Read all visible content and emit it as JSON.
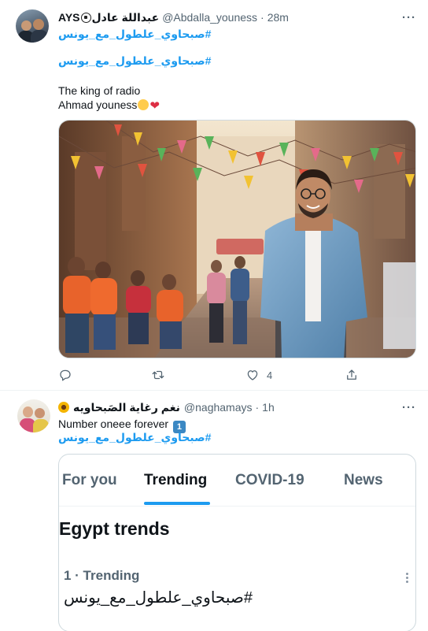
{
  "colors": {
    "accent": "#1d9bf0",
    "text": "#0f1419",
    "muted": "#536471",
    "heart": "#dd2e44"
  },
  "tweet1": {
    "display_name": "AYS",
    "display_name_arabic": "عبداللة عادل",
    "handle": "@Abdalla_youness",
    "time": "28m",
    "hashtag_1": "#صبحاوي_علطول_مع_يونس",
    "hashtag_2": "#صبحاوي_علطول_مع_يونس",
    "line_1": "The king of radio",
    "line_2": "Ahmad youness",
    "photo_icon": "photo-street-portrait",
    "actions": {
      "reply_icon": "reply-icon",
      "retweet_icon": "retweet-icon",
      "like_icon": "heart-outline-icon",
      "like_count": "4",
      "share_icon": "share-icon"
    }
  },
  "tweet2": {
    "display_name": "نغم رغاية الصَبحاويه",
    "handle": "@naghamays",
    "time": "1h",
    "line_1": "Number oneee forever",
    "keycap": "1",
    "hashtag": "#صبحاوي_علطول_مع_يونس",
    "card": {
      "tabs": [
        "For you",
        "Trending",
        "COVID-19",
        "News"
      ],
      "active_tab": "Trending",
      "section_title": "Egypt trends",
      "trend_meta": "1 · Trending",
      "trend_tag": "#صبحاوي_علطول_مع_يونس"
    }
  }
}
